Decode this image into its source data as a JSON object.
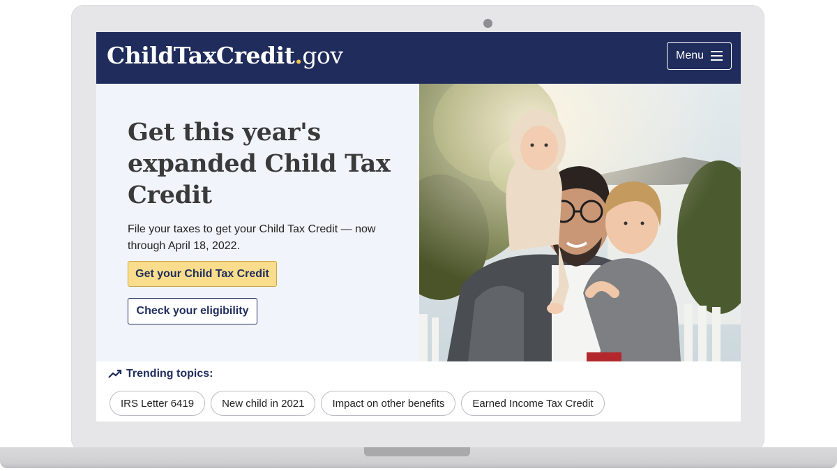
{
  "site": {
    "logo_main": "ChildTaxCredit",
    "logo_dot": ".",
    "logo_tld": "gov",
    "menu_label": "Menu"
  },
  "hero": {
    "title": "Get this year's expanded Child Tax Credit",
    "subtitle": "File your taxes to get your Child Tax Credit — now through April 18, 2022.",
    "primary_button": "Get your Child Tax Credit",
    "secondary_button": "Check your eligibility",
    "image_icon": "family-photo"
  },
  "trending": {
    "heading": "Trending topics:",
    "icon": "trending-up-icon",
    "topics": [
      "IRS Letter 6419",
      "New child in 2021",
      "Impact on other benefits",
      "Earned Income Tax Credit"
    ]
  },
  "colors": {
    "navy": "#1f2c5c",
    "gold": "#fadd8c",
    "hero_bg": "#f1f4fa"
  }
}
